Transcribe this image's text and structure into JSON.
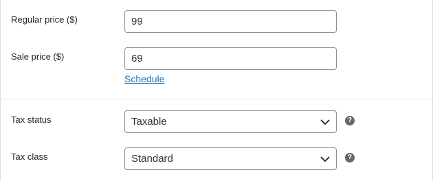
{
  "pricing": {
    "regular_label": "Regular price ($)",
    "regular_value": "99",
    "sale_label": "Sale price ($)",
    "sale_value": "69",
    "schedule_link": "Schedule"
  },
  "tax": {
    "status_label": "Tax status",
    "status_value": "Taxable",
    "class_label": "Tax class",
    "class_value": "Standard"
  },
  "icons": {
    "help": "help-icon",
    "help_glyph": "?",
    "dropdown": "chevron-down-icon"
  }
}
